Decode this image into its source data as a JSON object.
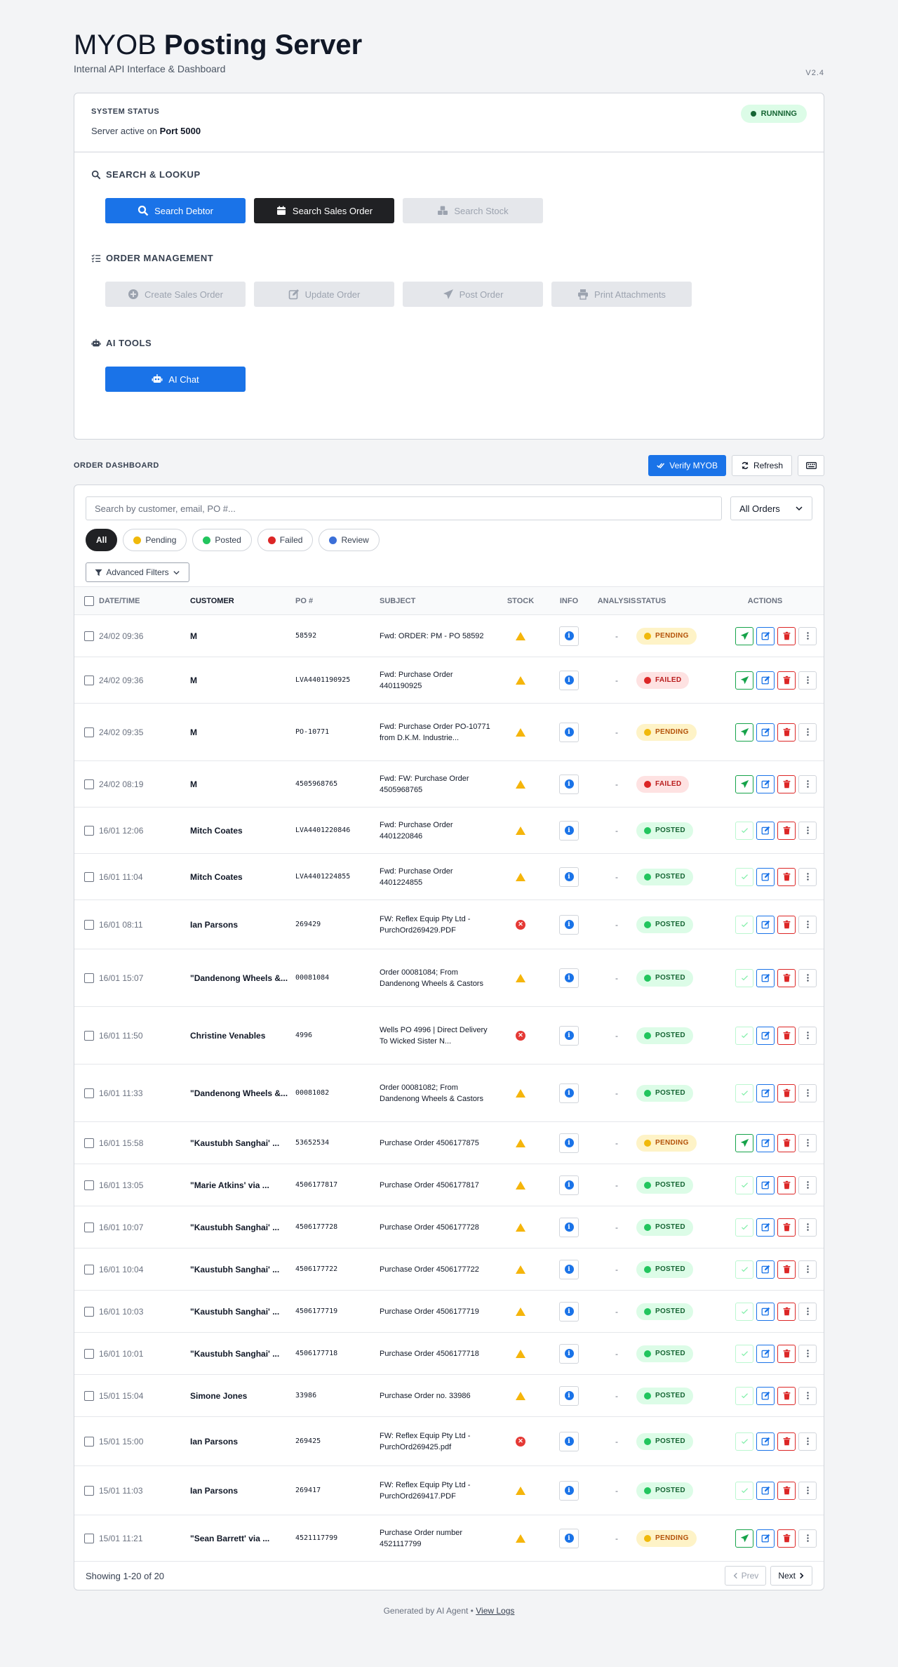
{
  "header": {
    "title_light": "MYOB",
    "title_bold": "Posting Server",
    "subtitle": "Internal API Interface & Dashboard",
    "version": "V2.4"
  },
  "system_status": {
    "label": "SYSTEM STATUS",
    "text": "Server active on",
    "port": "Port 5000",
    "badge": "RUNNING"
  },
  "sections": {
    "search": {
      "title": "SEARCH & LOOKUP",
      "buttons": [
        "Search Debtor",
        "Search Sales Order",
        "Search Stock"
      ]
    },
    "orders": {
      "title": "ORDER MANAGEMENT",
      "buttons": [
        "Create Sales Order",
        "Update Order",
        "Post Order",
        "Print Attachments"
      ]
    },
    "ai": {
      "title": "AI TOOLS",
      "buttons": [
        "AI Chat"
      ]
    }
  },
  "dashboard": {
    "title": "ORDER DASHBOARD",
    "verify_label": "Verify MYOB",
    "refresh_label": "Refresh",
    "search_placeholder": "Search by customer, email, PO #...",
    "filter_select": "All Orders",
    "pills": [
      "All",
      "Pending",
      "Posted",
      "Failed",
      "Review"
    ],
    "advanced_filters": "Advanced Filters",
    "columns": [
      "DATE/TIME",
      "CUSTOMER",
      "PO #",
      "SUBJECT",
      "STOCK",
      "INFO",
      "ANALYSIS",
      "STATUS",
      "ACTIONS"
    ],
    "showing": "Showing 1-20 of 20",
    "prev_label": "Prev",
    "next_label": "Next"
  },
  "orders": [
    {
      "date": "24/02 09:36",
      "customer": "M",
      "po": "58592",
      "subject": "Fwd: ORDER: PM - PO 58592",
      "stock": "warn",
      "analysis": "-",
      "status": "PENDING"
    },
    {
      "date": "24/02 09:36",
      "customer": "M",
      "po": "LVA4401190925",
      "subject": "Fwd: Purchase Order 4401190925",
      "stock": "warn",
      "analysis": "-",
      "status": "FAILED"
    },
    {
      "date": "24/02 09:35",
      "customer": "M",
      "po": "PO-10771",
      "subject": "Fwd: Purchase Order PO-10771 from D.K.M. Industrie...",
      "stock": "warn",
      "analysis": "-",
      "status": "PENDING"
    },
    {
      "date": "24/02 08:19",
      "customer": "M",
      "po": "4505968765",
      "subject": "Fwd: FW: Purchase Order 4505968765",
      "stock": "warn",
      "analysis": "-",
      "status": "FAILED"
    },
    {
      "date": "16/01 12:06",
      "customer": "Mitch Coates",
      "po": "LVA4401220846",
      "subject": "Fwd: Purchase Order 4401220846",
      "stock": "warn",
      "analysis": "-",
      "status": "POSTED"
    },
    {
      "date": "16/01 11:04",
      "customer": "Mitch Coates",
      "po": "LVA4401224855",
      "subject": "Fwd: Purchase Order 4401224855",
      "stock": "warn",
      "analysis": "-",
      "status": "POSTED"
    },
    {
      "date": "16/01 08:11",
      "customer": "Ian Parsons",
      "po": "269429",
      "subject": "FW: Reflex Equip Pty Ltd - PurchOrd269429.PDF",
      "stock": "error",
      "analysis": "-",
      "status": "POSTED"
    },
    {
      "date": "16/01 15:07",
      "customer": "\"Dandenong Wheels &...",
      "po": "00081084",
      "subject": "Order 00081084; From Dandenong Wheels & Castors",
      "stock": "warn",
      "analysis": "-",
      "status": "POSTED"
    },
    {
      "date": "16/01 11:50",
      "customer": "Christine Venables",
      "po": "4996",
      "subject": "Wells PO 4996 | Direct Delivery To Wicked Sister N...",
      "stock": "error",
      "analysis": "-",
      "status": "POSTED"
    },
    {
      "date": "16/01 11:33",
      "customer": "\"Dandenong Wheels &...",
      "po": "00081082",
      "subject": "Order 00081082; From Dandenong Wheels & Castors",
      "stock": "warn",
      "analysis": "-",
      "status": "POSTED"
    },
    {
      "date": "16/01 15:58",
      "customer": "\"Kaustubh Sanghai' ...",
      "po": "53652534",
      "subject": "Purchase Order 4506177875",
      "stock": "warn",
      "analysis": "-",
      "status": "PENDING"
    },
    {
      "date": "16/01 13:05",
      "customer": "\"Marie Atkins' via ...",
      "po": "4506177817",
      "subject": "Purchase Order 4506177817",
      "stock": "warn",
      "analysis": "-",
      "status": "POSTED"
    },
    {
      "date": "16/01 10:07",
      "customer": "\"Kaustubh Sanghai' ...",
      "po": "4506177728",
      "subject": "Purchase Order 4506177728",
      "stock": "warn",
      "analysis": "-",
      "status": "POSTED"
    },
    {
      "date": "16/01 10:04",
      "customer": "\"Kaustubh Sanghai' ...",
      "po": "4506177722",
      "subject": "Purchase Order 4506177722",
      "stock": "warn",
      "analysis": "-",
      "status": "POSTED"
    },
    {
      "date": "16/01 10:03",
      "customer": "\"Kaustubh Sanghai' ...",
      "po": "4506177719",
      "subject": "Purchase Order 4506177719",
      "stock": "warn",
      "analysis": "-",
      "status": "POSTED"
    },
    {
      "date": "16/01 10:01",
      "customer": "\"Kaustubh Sanghai' ...",
      "po": "4506177718",
      "subject": "Purchase Order 4506177718",
      "stock": "warn",
      "analysis": "-",
      "status": "POSTED"
    },
    {
      "date": "15/01 15:04",
      "customer": "Simone Jones",
      "po": "33986",
      "subject": "Purchase Order no. 33986",
      "stock": "warn",
      "analysis": "-",
      "status": "POSTED"
    },
    {
      "date": "15/01 15:00",
      "customer": "Ian Parsons",
      "po": "269425",
      "subject": "FW: Reflex Equip Pty Ltd - PurchOrd269425.pdf",
      "stock": "error",
      "analysis": "-",
      "status": "POSTED"
    },
    {
      "date": "15/01 11:03",
      "customer": "Ian Parsons",
      "po": "269417",
      "subject": "FW: Reflex Equip Pty Ltd - PurchOrd269417.PDF",
      "stock": "warn",
      "analysis": "-",
      "status": "POSTED"
    },
    {
      "date": "15/01 11:21",
      "customer": "\"Sean Barrett' via ...",
      "po": "4521117799",
      "subject": "Purchase Order number 4521117799",
      "stock": "warn",
      "analysis": "-",
      "status": "PENDING"
    }
  ],
  "footer": {
    "text": "Generated by AI Agent •",
    "link": "View Logs"
  },
  "colors": {
    "primary": "#1a73e8",
    "dark": "#202124",
    "pending": "#f0b90b",
    "posted": "#22c55e",
    "failed": "#dc2626",
    "review": "#3b6fd8"
  }
}
